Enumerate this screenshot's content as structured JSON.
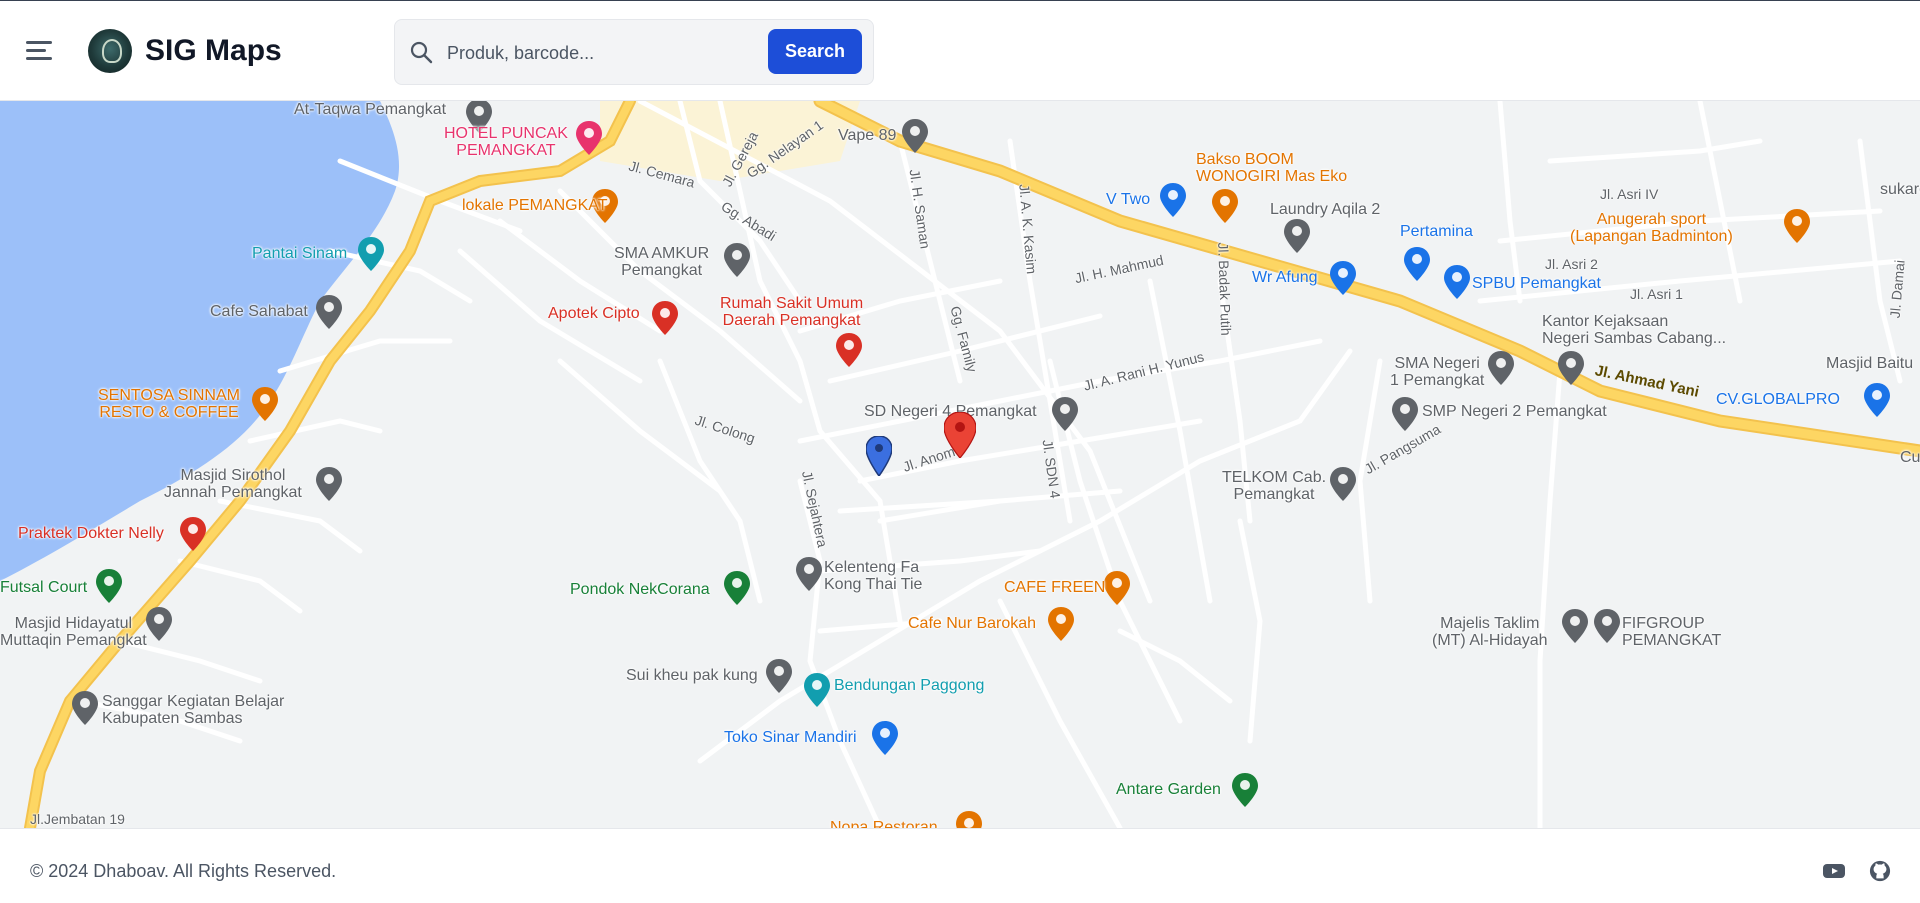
{
  "header": {
    "brand": "SIG Maps",
    "search_placeholder": "Produk, barcode...",
    "search_button": "Search"
  },
  "map": {
    "roads": {
      "main_road": "Jl. Ahmad Yani",
      "bottom_road": "Jl.Jembatan 19"
    },
    "streets": [
      "Jl. Cemara",
      "Jl. Gereja",
      "Gg. Nelayan 1",
      "Gg. Abadi",
      "Jl. H. Saman",
      "Jl. A. K. Kasim",
      "Jl. H. Mahmud",
      "Jl. Badak Putih",
      "Gg. Family",
      "Jl. A. Rani H. Yunus",
      "Jl. Colong",
      "Jl. Anom",
      "Jl. Sejahtera",
      "Jl. SDN 4",
      "Jl. Pangsuma",
      "Jl. Asri IV",
      "Jl. Asri 2",
      "Jl. Asri 1",
      "Jl. Damai"
    ],
    "places": [
      {
        "name": "At-Taqwa Pemangkat",
        "color": "#5f6368"
      },
      {
        "name": "HOTEL PUNCAK\nPEMANGKAT",
        "color": "#e8336d"
      },
      {
        "name": "Vape 89",
        "color": "#5f6368"
      },
      {
        "name": "lokale PEMANGKAT",
        "color": "#e37400"
      },
      {
        "name": "Bakso BOOM\nWONOGIRI Mas Eko",
        "color": "#e37400"
      },
      {
        "name": "V Two",
        "color": "#1a73e8"
      },
      {
        "name": "Laundry Aqila 2",
        "color": "#5f6368"
      },
      {
        "name": "Pertamina",
        "color": "#1a73e8"
      },
      {
        "name": "Pantai Sinam",
        "color": "#129eaf"
      },
      {
        "name": "SMA AMKUR\nPemangkat",
        "color": "#5f6368"
      },
      {
        "name": "Wr Afung",
        "color": "#1a73e8"
      },
      {
        "name": "SPBU Pemangkat",
        "color": "#1a73e8"
      },
      {
        "name": "Anugerah sport\n(Lapangan Badminton)",
        "color": "#e37400"
      },
      {
        "name": "sukard",
        "color": "#5f6368"
      },
      {
        "name": "Cafe Sahabat",
        "color": "#5f6368"
      },
      {
        "name": "Rumah Sakit Umum\nDaerah Pemangkat",
        "color": "#d93025"
      },
      {
        "name": "Apotek Cipto",
        "color": "#d93025"
      },
      {
        "name": "Kantor Kejaksaan\nNegeri Sambas Cabang...",
        "color": "#5f6368"
      },
      {
        "name": "SMA Negeri\n1 Pemangkat",
        "color": "#5f6368"
      },
      {
        "name": "Masjid Baitu",
        "color": "#5f6368"
      },
      {
        "name": "SENTOSA SINNAM\nRESTO & COFFEE",
        "color": "#e37400"
      },
      {
        "name": "SD Negeri 4 Pemangkat",
        "color": "#5f6368"
      },
      {
        "name": "CV.GLOBALPRO",
        "color": "#1a73e8"
      },
      {
        "name": "SMP Negeri 2 Pemangkat",
        "color": "#5f6368"
      },
      {
        "name": "Masjid Sirothol\nJannah Pemangkat",
        "color": "#5f6368"
      },
      {
        "name": "TELKOM Cab.\nPemangkat",
        "color": "#5f6368"
      },
      {
        "name": "Cu",
        "color": "#5f6368"
      },
      {
        "name": "Praktek Dokter Nelly",
        "color": "#d93025"
      },
      {
        "name": "Kelenteng Fa\nKong Thai Tie",
        "color": "#5f6368"
      },
      {
        "name": "Pondok NekCorana",
        "color": "#188038"
      },
      {
        "name": "CAFE FREEN",
        "color": "#e37400"
      },
      {
        "name": "Futsal Court",
        "color": "#188038"
      },
      {
        "name": "Masjid Hidayatul\nMuttaqin Pemangkat",
        "color": "#5f6368"
      },
      {
        "name": "Cafe Nur Barokah",
        "color": "#e37400"
      },
      {
        "name": "Majelis Taklim\n(MT) Al-Hidayah",
        "color": "#5f6368"
      },
      {
        "name": "FIFGROUP\nPEMANGKAT",
        "color": "#5f6368"
      },
      {
        "name": "Sui kheu pak kung",
        "color": "#5f6368"
      },
      {
        "name": "Bendungan Paggong",
        "color": "#129eaf"
      },
      {
        "name": "Sanggar Kegiatan Belajar\nKabupaten Sambas",
        "color": "#5f6368"
      },
      {
        "name": "Toko Sinar Mandiri",
        "color": "#1a73e8"
      },
      {
        "name": "Antare Garden",
        "color": "#188038"
      },
      {
        "name": "Nopa Restoran",
        "color": "#e37400"
      }
    ]
  },
  "footer": {
    "copyright": "© 2024 Dhaboav. All Rights Reserved."
  },
  "colors": {
    "accent": "#1d4ed8",
    "water": "#9cc0f9",
    "main_road": "#fdd663"
  }
}
